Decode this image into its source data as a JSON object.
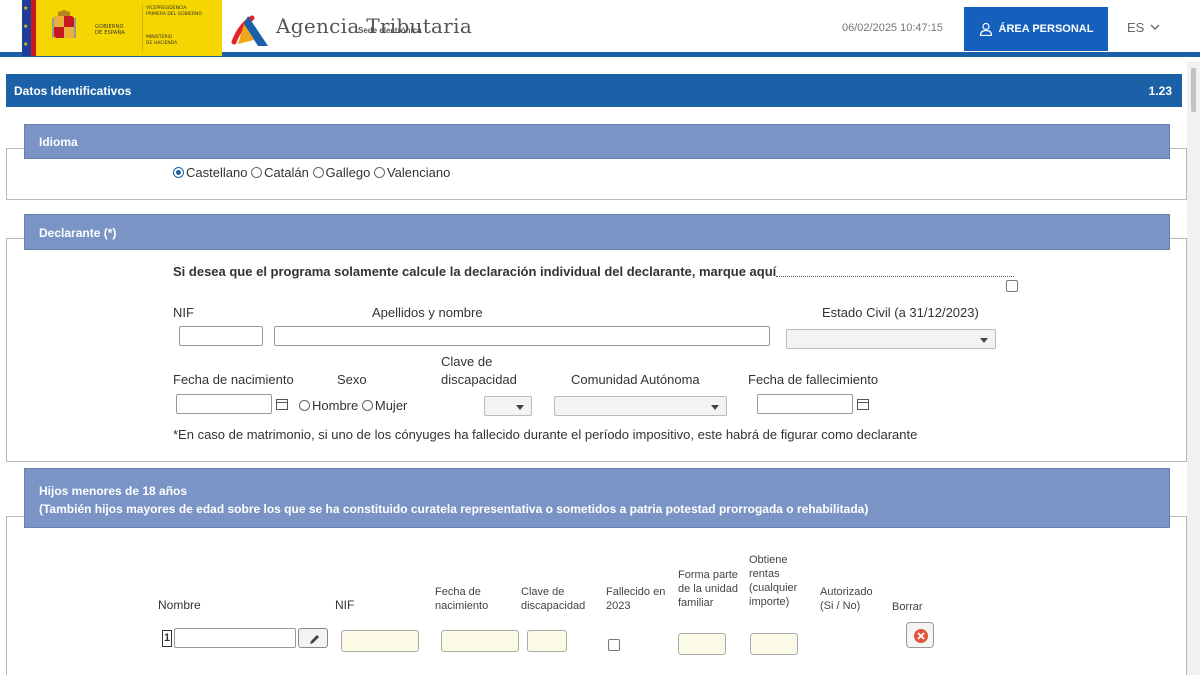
{
  "header": {
    "gov_line1": "GOBIERNO",
    "gov_line2": "DE ESPAÑA",
    "vice_line1": "VICEPRESIDENCIA",
    "vice_line2": "PRIMERA DEL GOBIERNO",
    "min_line1": "MINISTERIO",
    "min_line2": "DE HACIENDA",
    "agency": "Agencia Tributaria",
    "sede": "Sede electrónica",
    "datetime": "06/02/2025 10:47:15",
    "area_personal": "ÁREA PERSONAL",
    "lang": "ES",
    "brand_blue": "#1560bd",
    "gov_yellow": "#f6d600"
  },
  "main": {
    "title": "Datos Identificativos",
    "version": "1.23"
  },
  "idioma": {
    "title": "Idioma",
    "options": [
      "Castellano",
      "Catalán",
      "Gallego",
      "Valenciano"
    ],
    "selected": "Castellano"
  },
  "declarante": {
    "title": "Declarante (*)",
    "individual_text": "Si desea que el programa solamente calcule la declaración individual del declarante, marque aquí",
    "nif_label": "NIF",
    "nombre_label": "Apellidos y nombre",
    "estado_civil_label": "Estado Civil (a 31/12/2023)",
    "fecha_nac_label": "Fecha de nacimiento",
    "sexo_label": "Sexo",
    "discapacidad_label_1": "Clave de",
    "discapacidad_label_2": "discapacidad",
    "comunidad_label": "Comunidad Autónoma",
    "fallecimiento_label": "Fecha de fallecimiento",
    "sexo_options": [
      "Hombre",
      "Mujer"
    ],
    "note": "*En caso de matrimonio, si uno de los cónyuges ha fallecido durante el período impositivo, este habrá de figurar como declarante"
  },
  "hijos": {
    "title_1": "Hijos menores de 18 años",
    "title_2": "(También hijos mayores de edad sobre los que se ha constituido curatela representativa o sometidos a patria potestad prorrogada o rehabilitada)",
    "columns": {
      "nombre": "Nombre",
      "nif": "NIF",
      "fecha_1": "Fecha de",
      "fecha_2": "nacimiento",
      "clave_1": "Clave de",
      "clave_2": "discapacidad",
      "fallecido_1": "Fallecido en",
      "fallecido_2": "2023",
      "forma_1": "Forma parte",
      "forma_2": "de la unidad",
      "forma_3": "familiar",
      "obtiene_1": "Obtiene",
      "obtiene_2": "rentas",
      "obtiene_3": "(cualquier",
      "obtiene_4": "importe)",
      "autorizado_1": "Autorizado",
      "autorizado_2": "(Si / No)",
      "borrar": "Borrar"
    },
    "row_index": "1"
  }
}
